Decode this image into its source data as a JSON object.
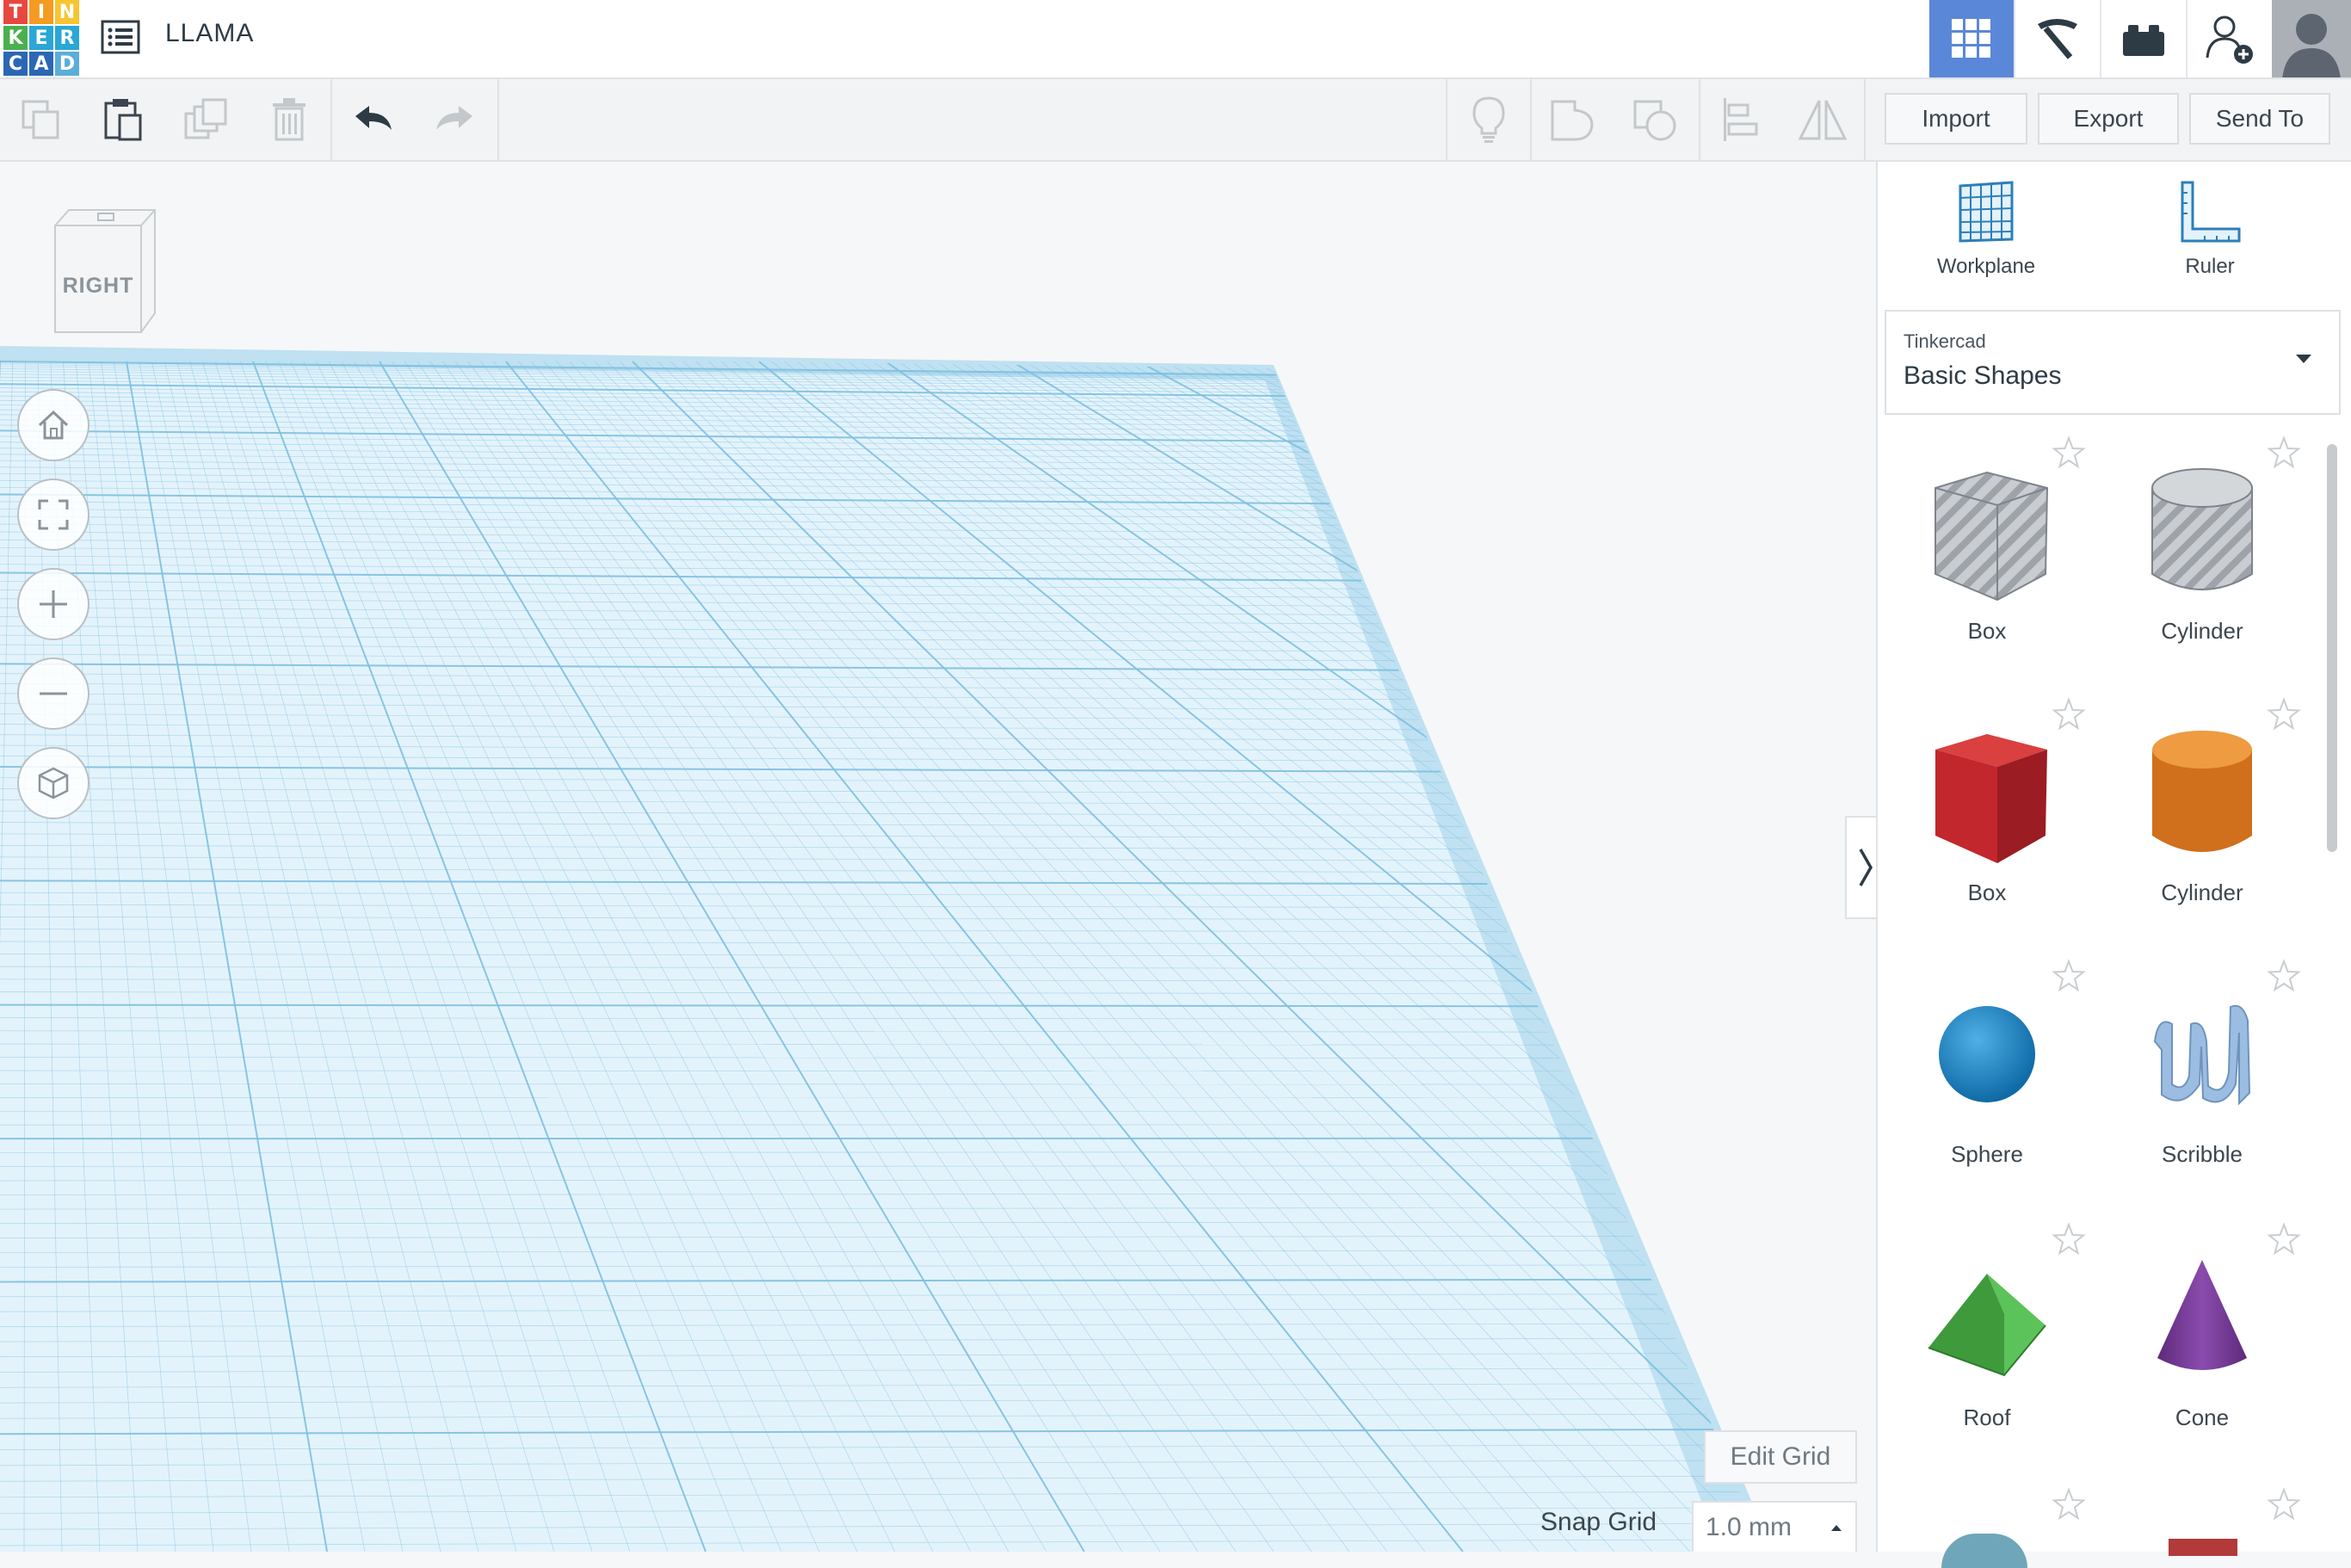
{
  "app": {
    "logo_letters": [
      "T",
      "I",
      "N",
      "K",
      "E",
      "R",
      "C",
      "A",
      "D"
    ],
    "logo_colors": [
      "#e8473f",
      "#f49b21",
      "#f7c531",
      "#4caf50",
      "#2aa7d6",
      "#2aa7d6",
      "#2b67b4",
      "#2b67b4",
      "#5aaed9"
    ],
    "design_title": "LLAMA"
  },
  "topbar": {
    "buttons": [
      {
        "icon": "grid-view-icon",
        "active": true
      },
      {
        "icon": "pickaxe-icon",
        "active": false
      },
      {
        "icon": "brick-icon",
        "active": false
      },
      {
        "icon": "add-user-icon",
        "active": false
      }
    ]
  },
  "toolbar": {
    "tools": [
      "copy-icon",
      "paste-icon",
      "duplicate-icon",
      "delete-icon",
      "undo-icon",
      "redo-icon"
    ],
    "right_tools": [
      "lightbulb-icon",
      "group-icon",
      "ungroup-icon",
      "align-icon",
      "mirror-icon"
    ],
    "import_label": "Import",
    "export_label": "Export",
    "sendto_label": "Send To"
  },
  "viewcube": {
    "face_label": "RIGHT"
  },
  "nav_controls": [
    "home-icon",
    "fit-view-icon",
    "zoom-in-icon",
    "zoom-out-icon",
    "perspective-icon"
  ],
  "workspace": {
    "edit_grid_label": "Edit Grid",
    "snap_grid_label": "Snap Grid",
    "snap_grid_value": "1.0 mm"
  },
  "panel": {
    "workplane_label": "Workplane",
    "ruler_label": "Ruler",
    "library_source": "Tinkercad",
    "library_name": "Basic Shapes",
    "shapes": [
      {
        "name": "Box",
        "icon": "box-hole-icon",
        "color": "#b9bcc1"
      },
      {
        "name": "Cylinder",
        "icon": "cylinder-hole-icon",
        "color": "#b9bcc1"
      },
      {
        "name": "Box",
        "icon": "box-icon",
        "color": "#c1272d"
      },
      {
        "name": "Cylinder",
        "icon": "cylinder-icon",
        "color": "#e07b22"
      },
      {
        "name": "Sphere",
        "icon": "sphere-icon",
        "color": "#1a87c8"
      },
      {
        "name": "Scribble",
        "icon": "scribble-icon",
        "color": "#8fb3d9"
      },
      {
        "name": "Roof",
        "icon": "roof-icon",
        "color": "#46a843"
      },
      {
        "name": "Cone",
        "icon": "cone-icon",
        "color": "#7a3d9a"
      }
    ]
  },
  "colors": {
    "accent": "#5b87d8",
    "grid_fill": "#d9eef8",
    "grid_line": "#7fc0e0"
  }
}
